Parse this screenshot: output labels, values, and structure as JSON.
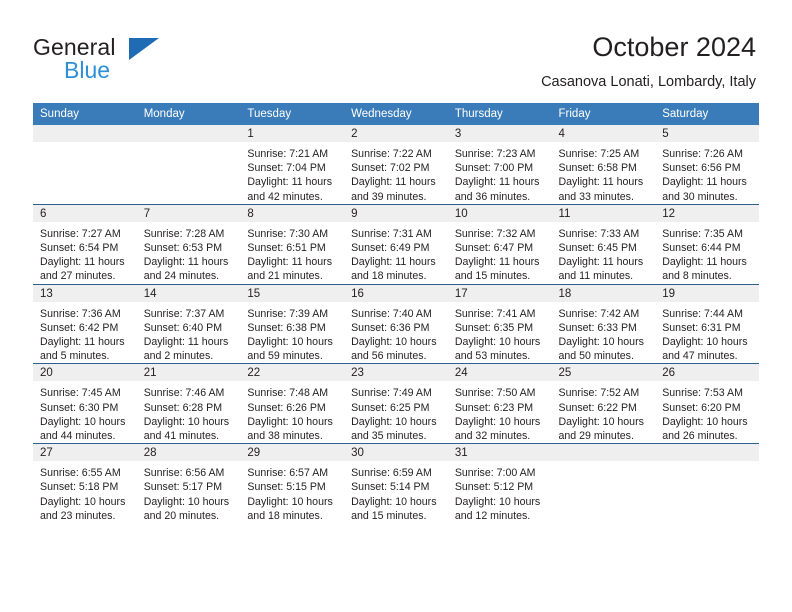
{
  "brand": {
    "name_part1": "General",
    "name_part2": "Blue",
    "triangle_color": "#1f6cb4",
    "blue_color": "#2e8fd6"
  },
  "header": {
    "title": "October 2024",
    "subtitle": "Casanova Lonati, Lombardy, Italy"
  },
  "theme": {
    "header_row_bg": "#3a7cb9",
    "row_divider": "#2c5f93",
    "daynum_band_bg": "#efefef",
    "text": "#231f20"
  },
  "calendar": {
    "weekday_headers": [
      "Sunday",
      "Monday",
      "Tuesday",
      "Wednesday",
      "Thursday",
      "Friday",
      "Saturday"
    ],
    "weeks": [
      [
        {
          "day": "",
          "sunrise": "",
          "sunset": "",
          "daylight_line1": "",
          "daylight_line2": ""
        },
        {
          "day": "",
          "sunrise": "",
          "sunset": "",
          "daylight_line1": "",
          "daylight_line2": ""
        },
        {
          "day": "1",
          "sunrise": "Sunrise: 7:21 AM",
          "sunset": "Sunset: 7:04 PM",
          "daylight_line1": "Daylight: 11 hours",
          "daylight_line2": "and 42 minutes."
        },
        {
          "day": "2",
          "sunrise": "Sunrise: 7:22 AM",
          "sunset": "Sunset: 7:02 PM",
          "daylight_line1": "Daylight: 11 hours",
          "daylight_line2": "and 39 minutes."
        },
        {
          "day": "3",
          "sunrise": "Sunrise: 7:23 AM",
          "sunset": "Sunset: 7:00 PM",
          "daylight_line1": "Daylight: 11 hours",
          "daylight_line2": "and 36 minutes."
        },
        {
          "day": "4",
          "sunrise": "Sunrise: 7:25 AM",
          "sunset": "Sunset: 6:58 PM",
          "daylight_line1": "Daylight: 11 hours",
          "daylight_line2": "and 33 minutes."
        },
        {
          "day": "5",
          "sunrise": "Sunrise: 7:26 AM",
          "sunset": "Sunset: 6:56 PM",
          "daylight_line1": "Daylight: 11 hours",
          "daylight_line2": "and 30 minutes."
        }
      ],
      [
        {
          "day": "6",
          "sunrise": "Sunrise: 7:27 AM",
          "sunset": "Sunset: 6:54 PM",
          "daylight_line1": "Daylight: 11 hours",
          "daylight_line2": "and 27 minutes."
        },
        {
          "day": "7",
          "sunrise": "Sunrise: 7:28 AM",
          "sunset": "Sunset: 6:53 PM",
          "daylight_line1": "Daylight: 11 hours",
          "daylight_line2": "and 24 minutes."
        },
        {
          "day": "8",
          "sunrise": "Sunrise: 7:30 AM",
          "sunset": "Sunset: 6:51 PM",
          "daylight_line1": "Daylight: 11 hours",
          "daylight_line2": "and 21 minutes."
        },
        {
          "day": "9",
          "sunrise": "Sunrise: 7:31 AM",
          "sunset": "Sunset: 6:49 PM",
          "daylight_line1": "Daylight: 11 hours",
          "daylight_line2": "and 18 minutes."
        },
        {
          "day": "10",
          "sunrise": "Sunrise: 7:32 AM",
          "sunset": "Sunset: 6:47 PM",
          "daylight_line1": "Daylight: 11 hours",
          "daylight_line2": "and 15 minutes."
        },
        {
          "day": "11",
          "sunrise": "Sunrise: 7:33 AM",
          "sunset": "Sunset: 6:45 PM",
          "daylight_line1": "Daylight: 11 hours",
          "daylight_line2": "and 11 minutes."
        },
        {
          "day": "12",
          "sunrise": "Sunrise: 7:35 AM",
          "sunset": "Sunset: 6:44 PM",
          "daylight_line1": "Daylight: 11 hours",
          "daylight_line2": "and 8 minutes."
        }
      ],
      [
        {
          "day": "13",
          "sunrise": "Sunrise: 7:36 AM",
          "sunset": "Sunset: 6:42 PM",
          "daylight_line1": "Daylight: 11 hours",
          "daylight_line2": "and 5 minutes."
        },
        {
          "day": "14",
          "sunrise": "Sunrise: 7:37 AM",
          "sunset": "Sunset: 6:40 PM",
          "daylight_line1": "Daylight: 11 hours",
          "daylight_line2": "and 2 minutes."
        },
        {
          "day": "15",
          "sunrise": "Sunrise: 7:39 AM",
          "sunset": "Sunset: 6:38 PM",
          "daylight_line1": "Daylight: 10 hours",
          "daylight_line2": "and 59 minutes."
        },
        {
          "day": "16",
          "sunrise": "Sunrise: 7:40 AM",
          "sunset": "Sunset: 6:36 PM",
          "daylight_line1": "Daylight: 10 hours",
          "daylight_line2": "and 56 minutes."
        },
        {
          "day": "17",
          "sunrise": "Sunrise: 7:41 AM",
          "sunset": "Sunset: 6:35 PM",
          "daylight_line1": "Daylight: 10 hours",
          "daylight_line2": "and 53 minutes."
        },
        {
          "day": "18",
          "sunrise": "Sunrise: 7:42 AM",
          "sunset": "Sunset: 6:33 PM",
          "daylight_line1": "Daylight: 10 hours",
          "daylight_line2": "and 50 minutes."
        },
        {
          "day": "19",
          "sunrise": "Sunrise: 7:44 AM",
          "sunset": "Sunset: 6:31 PM",
          "daylight_line1": "Daylight: 10 hours",
          "daylight_line2": "and 47 minutes."
        }
      ],
      [
        {
          "day": "20",
          "sunrise": "Sunrise: 7:45 AM",
          "sunset": "Sunset: 6:30 PM",
          "daylight_line1": "Daylight: 10 hours",
          "daylight_line2": "and 44 minutes."
        },
        {
          "day": "21",
          "sunrise": "Sunrise: 7:46 AM",
          "sunset": "Sunset: 6:28 PM",
          "daylight_line1": "Daylight: 10 hours",
          "daylight_line2": "and 41 minutes."
        },
        {
          "day": "22",
          "sunrise": "Sunrise: 7:48 AM",
          "sunset": "Sunset: 6:26 PM",
          "daylight_line1": "Daylight: 10 hours",
          "daylight_line2": "and 38 minutes."
        },
        {
          "day": "23",
          "sunrise": "Sunrise: 7:49 AM",
          "sunset": "Sunset: 6:25 PM",
          "daylight_line1": "Daylight: 10 hours",
          "daylight_line2": "and 35 minutes."
        },
        {
          "day": "24",
          "sunrise": "Sunrise: 7:50 AM",
          "sunset": "Sunset: 6:23 PM",
          "daylight_line1": "Daylight: 10 hours",
          "daylight_line2": "and 32 minutes."
        },
        {
          "day": "25",
          "sunrise": "Sunrise: 7:52 AM",
          "sunset": "Sunset: 6:22 PM",
          "daylight_line1": "Daylight: 10 hours",
          "daylight_line2": "and 29 minutes."
        },
        {
          "day": "26",
          "sunrise": "Sunrise: 7:53 AM",
          "sunset": "Sunset: 6:20 PM",
          "daylight_line1": "Daylight: 10 hours",
          "daylight_line2": "and 26 minutes."
        }
      ],
      [
        {
          "day": "27",
          "sunrise": "Sunrise: 6:55 AM",
          "sunset": "Sunset: 5:18 PM",
          "daylight_line1": "Daylight: 10 hours",
          "daylight_line2": "and 23 minutes."
        },
        {
          "day": "28",
          "sunrise": "Sunrise: 6:56 AM",
          "sunset": "Sunset: 5:17 PM",
          "daylight_line1": "Daylight: 10 hours",
          "daylight_line2": "and 20 minutes."
        },
        {
          "day": "29",
          "sunrise": "Sunrise: 6:57 AM",
          "sunset": "Sunset: 5:15 PM",
          "daylight_line1": "Daylight: 10 hours",
          "daylight_line2": "and 18 minutes."
        },
        {
          "day": "30",
          "sunrise": "Sunrise: 6:59 AM",
          "sunset": "Sunset: 5:14 PM",
          "daylight_line1": "Daylight: 10 hours",
          "daylight_line2": "and 15 minutes."
        },
        {
          "day": "31",
          "sunrise": "Sunrise: 7:00 AM",
          "sunset": "Sunset: 5:12 PM",
          "daylight_line1": "Daylight: 10 hours",
          "daylight_line2": "and 12 minutes."
        },
        {
          "day": "",
          "sunrise": "",
          "sunset": "",
          "daylight_line1": "",
          "daylight_line2": ""
        },
        {
          "day": "",
          "sunrise": "",
          "sunset": "",
          "daylight_line1": "",
          "daylight_line2": ""
        }
      ]
    ]
  }
}
